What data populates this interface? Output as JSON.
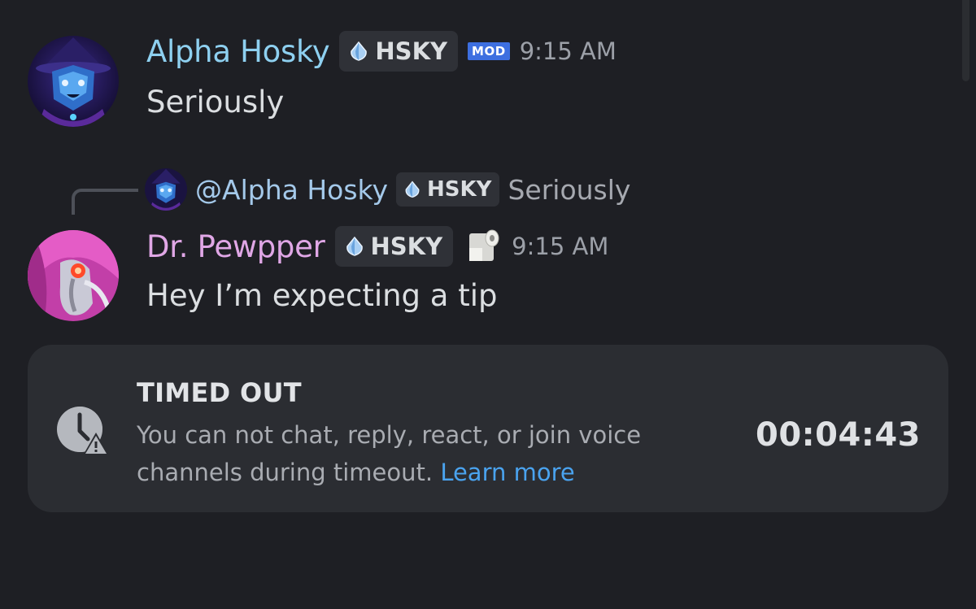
{
  "messages": [
    {
      "author": "Alpha Hosky",
      "author_color": "#8ed0f0",
      "tag": "HSKY",
      "badge": "MOD",
      "time": "9:15 AM",
      "content": "Seriously"
    },
    {
      "reply_to": {
        "mention": "@Alpha Hosky",
        "tag": "HSKY",
        "preview": "Seriously"
      },
      "author": "Dr. Pewpper",
      "author_color": "#e0a7e6",
      "tag": "HSKY",
      "status_emoji": "toilet-paper-icon",
      "time": "9:15 AM",
      "content": "Hey I’m expecting a tip"
    }
  ],
  "timeout_notice": {
    "title": "TIMED OUT",
    "body": "You can not chat, reply, react, or join voice channels during timeout.",
    "link": "Learn more",
    "timer": "00:04:43",
    "link_color": "#4aa3ef"
  }
}
